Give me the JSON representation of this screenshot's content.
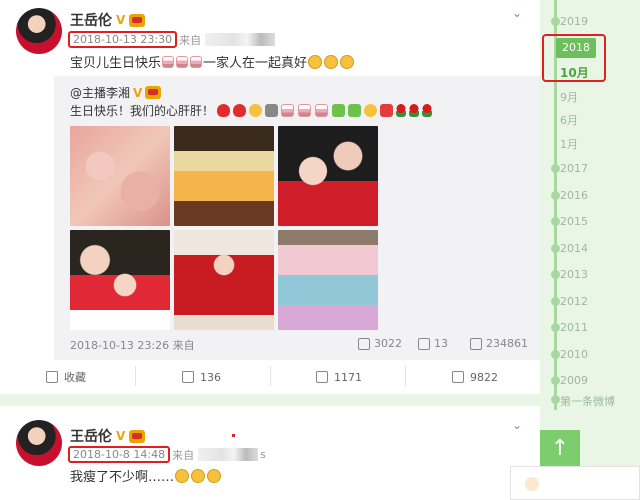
{
  "post1": {
    "username": "王岳伦",
    "v_badge": "V",
    "time": "2018-10-13 23:30",
    "source_prefix": "来自",
    "text_before_cakes": "宝贝儿生日快乐",
    "text_after_cakes": "一家人在一起真好",
    "repost": {
      "author": "@主播李湘",
      "v_badge": "V",
      "text": "生日快乐！我们的心肝肝！",
      "photos": [
        "photo-1",
        "photo-2",
        "photo-3",
        "photo-4",
        "photo-5",
        "photo-6"
      ],
      "time": "2018-10-13 23:26 来自",
      "shares": "3022",
      "comments": "13",
      "likes": "234861"
    },
    "actions": {
      "favorite": "收藏",
      "forward": "136",
      "comment": "1171",
      "like": "9822"
    }
  },
  "post2": {
    "username": "王岳伦",
    "v_badge": "V",
    "time": "2018-10-8 14:48",
    "source_prefix": "来自",
    "source_tail": "s",
    "text": "我瘦了不少啊……"
  },
  "timeline": {
    "years_top": [
      "2019"
    ],
    "selected_year": "2018",
    "selected_month": "10月",
    "months": [
      "9月",
      "6月",
      "1月"
    ],
    "years_bottom": [
      "2017",
      "2016",
      "2015",
      "2014",
      "2013",
      "2012",
      "2011",
      "2010",
      "2009"
    ],
    "first_post": "第一条微博"
  },
  "colors": {
    "accent_green": "#6dbf5c",
    "highlight_red": "#e02020",
    "page_bg": "#e9f6e6"
  },
  "icons": {
    "back_to_top": "↑",
    "expand": "⌄"
  }
}
